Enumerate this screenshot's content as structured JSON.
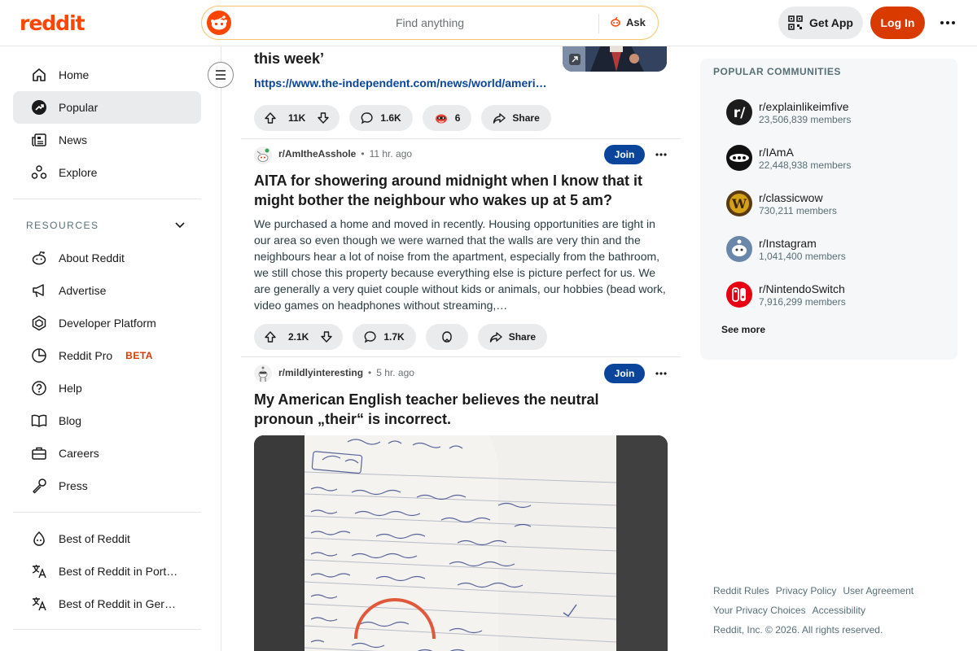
{
  "header": {
    "logo": "reddit",
    "search_placeholder": "Find anything",
    "ask_label": "Ask",
    "get_app_label": "Get App",
    "login_label": "Log In"
  },
  "sidebar": {
    "nav": [
      {
        "label": "Home",
        "icon": "home-icon"
      },
      {
        "label": "Popular",
        "icon": "popular-icon"
      },
      {
        "label": "News",
        "icon": "news-icon"
      },
      {
        "label": "Explore",
        "icon": "explore-icon"
      }
    ],
    "resources_label": "RESOURCES",
    "resources": [
      {
        "label": "About Reddit",
        "icon": "snoo-outline-icon"
      },
      {
        "label": "Advertise",
        "icon": "megaphone-icon"
      },
      {
        "label": "Developer Platform",
        "icon": "developer-icon"
      },
      {
        "label": "Reddit Pro",
        "icon": "pro-icon",
        "badge": "BETA"
      },
      {
        "label": "Help",
        "icon": "help-icon"
      },
      {
        "label": "Blog",
        "icon": "book-icon"
      },
      {
        "label": "Careers",
        "icon": "briefcase-icon"
      },
      {
        "label": "Press",
        "icon": "press-icon"
      }
    ],
    "bottom": [
      {
        "label": "Best of Reddit",
        "icon": "best-icon"
      },
      {
        "label": "Best of Reddit in Port…",
        "icon": "translate-icon"
      },
      {
        "label": "Best of Reddit in Ger…",
        "icon": "translate-icon"
      }
    ]
  },
  "feed": {
    "post1": {
      "title_tail": "this week’",
      "link": "https://www.the-independent.com/news/world/ameri…",
      "votes": "11K",
      "comments": "1.6K",
      "awards": "6",
      "share": "Share"
    },
    "post2": {
      "subreddit": "r/AmItheAsshole",
      "time": "11 hr. ago",
      "join": "Join",
      "title": "AITA for showering around midnight when I know that it might bother the neighbour who wakes up at 5 am?",
      "body": "We purchased a home and moved in recently. Housing opportunities are tight in our area so even though we were warned that the walls are very thin and the neighbours hear a lot of noise from the apartment, especially from the bathroom, we still chose this property because everything else is picture perfect for us. We are generally a very quiet couple without kids or animals, our hobbies (bead work, video games on headphones without streaming,…",
      "votes": "2.1K",
      "comments": "1.7K",
      "share": "Share"
    },
    "post3": {
      "subreddit": "r/mildlyinteresting",
      "time": "5 hr. ago",
      "join": "Join",
      "title": "My American English teacher believes the neutral pronoun „their“ is incorrect."
    }
  },
  "right": {
    "title": "POPULAR COMMUNITIES",
    "communities": [
      {
        "name": "r/explainlikeimfive",
        "members": "23,506,839 members",
        "color": "#1c1c1c"
      },
      {
        "name": "r/IAmA",
        "members": "22,448,938 members",
        "color": "#111111"
      },
      {
        "name": "r/classicwow",
        "members": "730,211 members",
        "color": "#b8860b"
      },
      {
        "name": "r/Instagram",
        "members": "1,041,400 members",
        "color": "#5f7a9a"
      },
      {
        "name": "r/NintendoSwitch",
        "members": "7,916,299 members",
        "color": "#e60012"
      }
    ],
    "see_more": "See more",
    "footer": {
      "rules": "Reddit Rules",
      "privacy": "Privacy Policy",
      "agreement": "User Agreement",
      "choices": "Your Privacy Choices",
      "accessibility": "Accessibility",
      "copyright": "Reddit, Inc. © 2026. All rights reserved."
    }
  },
  "colors": {
    "brand": "#ff4500",
    "login": "#d93a00",
    "join": "#0a449b",
    "pill": "#e9ebed"
  }
}
